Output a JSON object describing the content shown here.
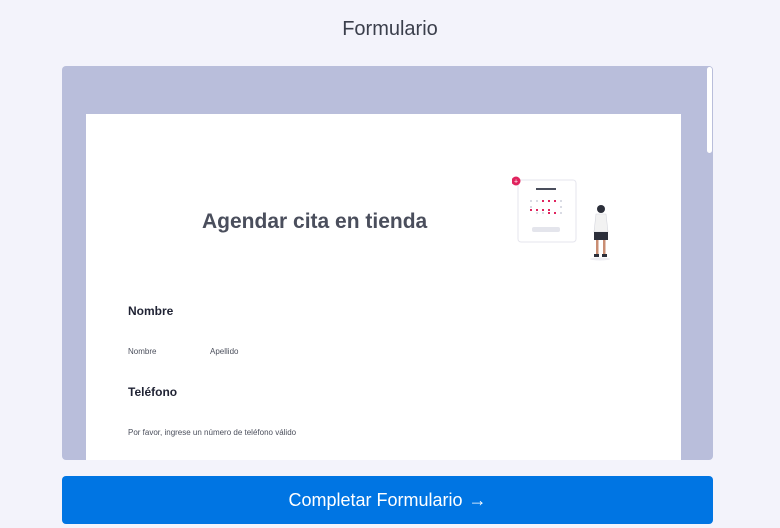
{
  "header": {
    "title": "Formulario"
  },
  "form": {
    "heading": "Agendar cita en tienda",
    "fields": {
      "name": {
        "label": "Nombre",
        "first_sublabel": "Nombre",
        "last_sublabel": "Apellido"
      },
      "phone": {
        "label": "Teléfono",
        "hint": "Por favor, ingrese un número de teléfono válido"
      }
    },
    "illustration": {
      "icon": "calendar-person-illustration",
      "badge_symbol": "+"
    }
  },
  "cta": {
    "label": "Completar Formulario",
    "arrow": "→"
  },
  "colors": {
    "page_bg": "#f3f3fb",
    "frame_bg": "#b9bedb",
    "accent_blue": "#0075e3",
    "accent_pink": "#e0245e"
  }
}
